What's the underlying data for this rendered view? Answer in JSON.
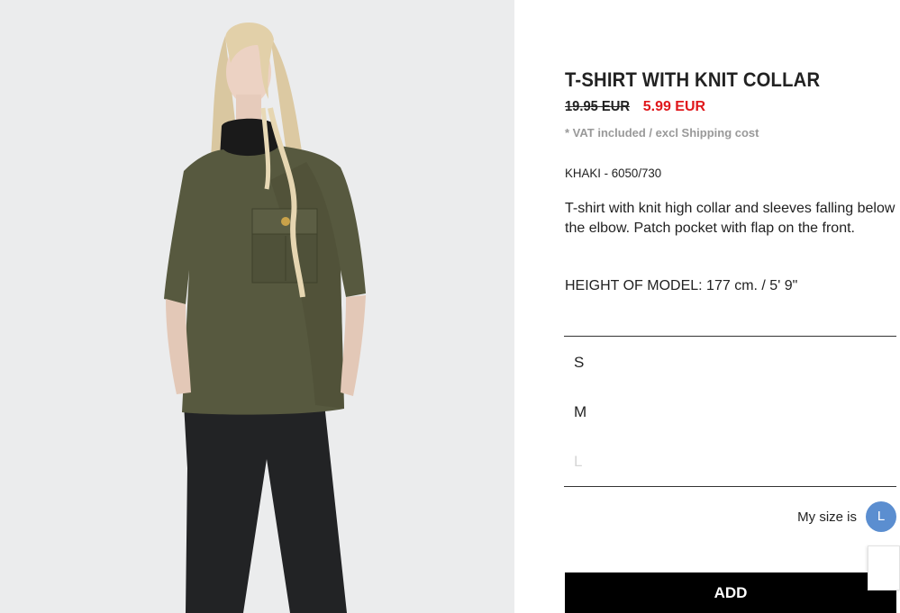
{
  "product": {
    "title": "T-SHIRT WITH KNIT COLLAR",
    "price_old": "19.95 EUR",
    "price_new": "5.99 EUR",
    "vat_note": "* VAT included / excl Shipping cost",
    "color_ref": "KHAKI - 6050/730",
    "description": "T-shirt with knit high collar and sleeves falling below the elbow. Patch pocket with flap on the front.",
    "model_height": "HEIGHT OF MODEL: 177 cm. / 5' 9\"",
    "sizes": [
      {
        "label": "S",
        "available": true
      },
      {
        "label": "M",
        "available": true
      },
      {
        "label": "L",
        "available": false
      }
    ],
    "my_size_label": "My size is",
    "my_size_value": "L",
    "add_label": "ADD"
  },
  "colors": {
    "sale_price": "#e0181c",
    "size_badge": "#5b8ed0",
    "button_bg": "#000000",
    "shirt": "#57593f"
  }
}
